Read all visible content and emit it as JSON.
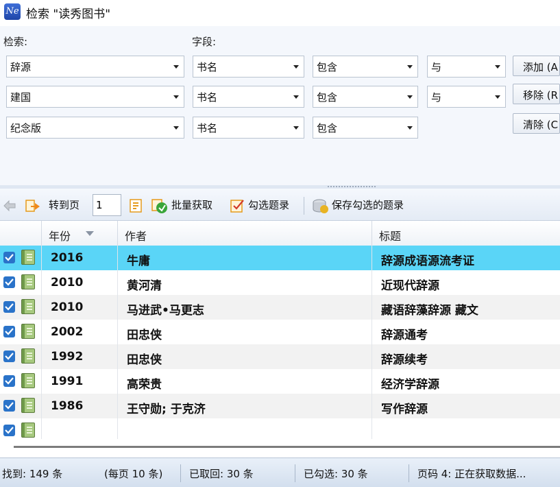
{
  "window": {
    "title": "检索 \"读秀图书\"",
    "app_icon_text": "Ne"
  },
  "search": {
    "keyword_label": "检索:",
    "field_label": "字段:",
    "rows": [
      {
        "keyword": "辞源",
        "field": "书名",
        "match": "包含",
        "logic": "与"
      },
      {
        "keyword": "建国",
        "field": "书名",
        "match": "包含",
        "logic": "与"
      },
      {
        "keyword": "纪念版",
        "field": "书名",
        "match": "包含"
      }
    ],
    "buttons": {
      "add": "添加 (A",
      "remove": "移除 (R",
      "clear": "清除 (C"
    }
  },
  "toolbar": {
    "goto_page_label": "转到页",
    "page_value": "1",
    "batch_fetch_label": "批量获取",
    "select_records_label": "勾选题录",
    "save_selected_label": "保存勾选的题录"
  },
  "table": {
    "columns": [
      "年份",
      "作者",
      "标题"
    ],
    "rows": [
      {
        "year": "2016",
        "author": "牛庸",
        "title": "辞源成语源流考证",
        "checked": true,
        "selected": true
      },
      {
        "year": "2010",
        "author": "黄河清",
        "title": "近现代辞源",
        "checked": true
      },
      {
        "year": "2010",
        "author": "马进武•马更志",
        "title": "藏语辞藻辞源 藏文",
        "checked": true
      },
      {
        "year": "2002",
        "author": "田忠侠",
        "title": "辞源通考",
        "checked": true
      },
      {
        "year": "1992",
        "author": "田忠侠",
        "title": "辞源续考",
        "checked": true
      },
      {
        "year": "1991",
        "author": "高荣贵",
        "title": "经济学辞源",
        "checked": true
      },
      {
        "year": "1986",
        "author": "王守勋; 于克济",
        "title": "写作辞源",
        "checked": true
      },
      {
        "year": "",
        "author": "",
        "title": "",
        "checked": true
      }
    ]
  },
  "status": {
    "found": "找到: 149 条",
    "per_page": "(每页 10 条)",
    "fetched": "已取回: 30 条",
    "selected": "已勾选: 30 条",
    "page_status": "页码 4: 正在获取数据..."
  },
  "colors": {
    "selected_row": "#5ad5f7",
    "checkbox": "#2a73c9",
    "toolbar": "#e4ebf5"
  }
}
